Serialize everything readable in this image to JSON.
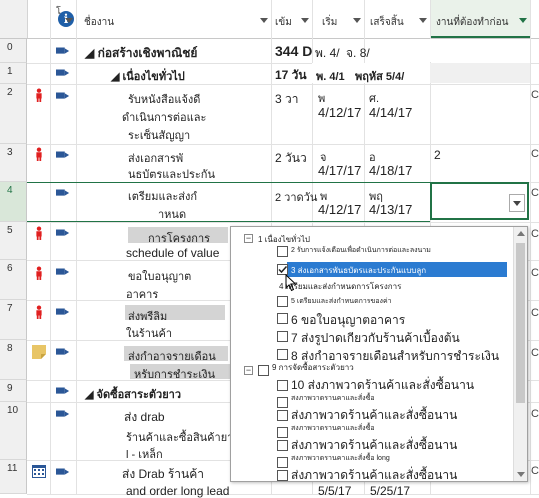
{
  "header": {
    "col_mode": "โ",
    "col_name": "ชื่องาน",
    "col_duration": "เข้ม",
    "col_start": "เริ่ม",
    "col_finish": "เสร็จสิ้น",
    "col_predecessors": "งานที่ต้องทำก่อน"
  },
  "rows": [
    {
      "num": "0",
      "name": "◢ ก่อสร้างเชิงพาณิชย์",
      "duration": "344 D",
      "start": "พ. 4/",
      "finish": "จ. 8/",
      "pred": ""
    },
    {
      "num": "1",
      "name": "◢ เนื่องไขทั่วไป",
      "duration": "17 วัน",
      "start": "พ. 4/1",
      "finish": "พฤหัส 5/4/",
      "pred": ""
    },
    {
      "num": "2",
      "name": "รับหนังสือแจ้งดี",
      "name2": "ดำเนินการต่อและ",
      "name3": "ระเซ็นสัญญา",
      "duration": "3 วา",
      "start": "พ",
      "start2": "4/12/17",
      "finish": "ศ.",
      "finish2": "4/14/17",
      "pred": ""
    },
    {
      "num": "3",
      "name": "ส่งเอกสารพั",
      "name2": "นธบัตรและประกัน",
      "duration": "2 วันว",
      "start": "จ",
      "start2": "4/17/17",
      "finish": "อ",
      "finish2": "4/18/17",
      "pred": "2"
    },
    {
      "num": "4",
      "name": "เตรียมและส่งกํ",
      "name2": "าหนด",
      "duration": "2 วาดวัน",
      "start": "พ",
      "start2": "4/12/17",
      "finish": "พฤ",
      "finish2": "4/13/17",
      "pred": ""
    },
    {
      "num": "5",
      "name": "การโครงการ",
      "name2": "schedule of value",
      "duration": "",
      "start": "",
      "finish": "",
      "pred": ""
    },
    {
      "num": "6",
      "name": "ขอใบอนุญาต",
      "name2": "อาคาร",
      "duration": "",
      "start": "",
      "finish": "",
      "pred": ""
    },
    {
      "num": "7",
      "name": "ส่งพรีลิม",
      "name2": "ในร้านค้า",
      "duration": "",
      "start": "",
      "finish": "",
      "pred": ""
    },
    {
      "num": "8",
      "name": "ส่งกำอาจรายเดือน",
      "name2": "หรับการชำระเงิน",
      "duration": "",
      "start": "",
      "finish": "",
      "pred": ""
    },
    {
      "num": "9",
      "name": "◢ จัดซื้อสาระตัวยาว",
      "duration": "",
      "start": "",
      "finish": "",
      "pred": ""
    },
    {
      "num": "10",
      "name": "ส่ง drab",
      "name2": "ร้านค้าและซื้อสินค้ายาว",
      "name3": "l - เหล็ก",
      "duration": "",
      "start": "",
      "finish": "",
      "pred": ""
    },
    {
      "num": "11",
      "name": "ส่ง Drab ร้านค้า",
      "name2": "and order long lead",
      "duration": "",
      "start": "5/5/17",
      "finish": "5/25/17",
      "pred": ""
    }
  ],
  "dropdown": {
    "items": [
      {
        "label": "1 เนื่องไขทั่วไป",
        "checked": false,
        "expander": "−"
      },
      {
        "label": "2 รับการแจ้งเตือนเพื่อดำเนินการต่อและลงนาม",
        "checked": false
      },
      {
        "label": "3 ส่งเอกสารพันธบัตรและประกันแบบลูก",
        "checked": true
      },
      {
        "label": "4 เตรียมและส่งกำหนดการโครงการ",
        "checked": false
      },
      {
        "label": "5 เตรียมและส่งกำหนดการของค่า",
        "checked": false
      },
      {
        "label": "6 ขอใบอนุญาตอาคาร",
        "checked": false
      },
      {
        "label": "7 ส่งรูปาดเกียวกับร้านค้าเบื้องต้น",
        "checked": false
      },
      {
        "label": "8 ส่งกำอาจรายเดือนสำหรับการชำระเงิน",
        "checked": false
      },
      {
        "label": "9 การจัดซื้อสาระตัวยาว",
        "checked": false,
        "expander": "−"
      },
      {
        "label": "10 ส่งภาพวาดร้านค้าและสั่งซื้อนาน",
        "checked": false
      },
      {
        "label": "สงภาพวาดรานคาและสั่งซื้อ",
        "checked": false
      },
      {
        "label": "ส่งภาพวาดร้านค้าและสั่งซื้อนาน",
        "checked": false
      },
      {
        "label": "สงภาพวาดรานคาและสั่งซื้อ",
        "checked": false
      },
      {
        "label": "ส่งภาพวาดร้านค้าและสั่งซื้อนาน",
        "checked": false
      },
      {
        "label": "สงภาพวาดรานคาและสั่งซื้อ long",
        "checked": false
      },
      {
        "label": "ส่งภาพวาดร้านค้าและสั่งซื้อนาน",
        "checked": false
      }
    ]
  },
  "colors": {
    "accent": "#2b7bd1",
    "task_icon": "#2b5797",
    "person": "#e02020",
    "selected_border": "#217346"
  }
}
